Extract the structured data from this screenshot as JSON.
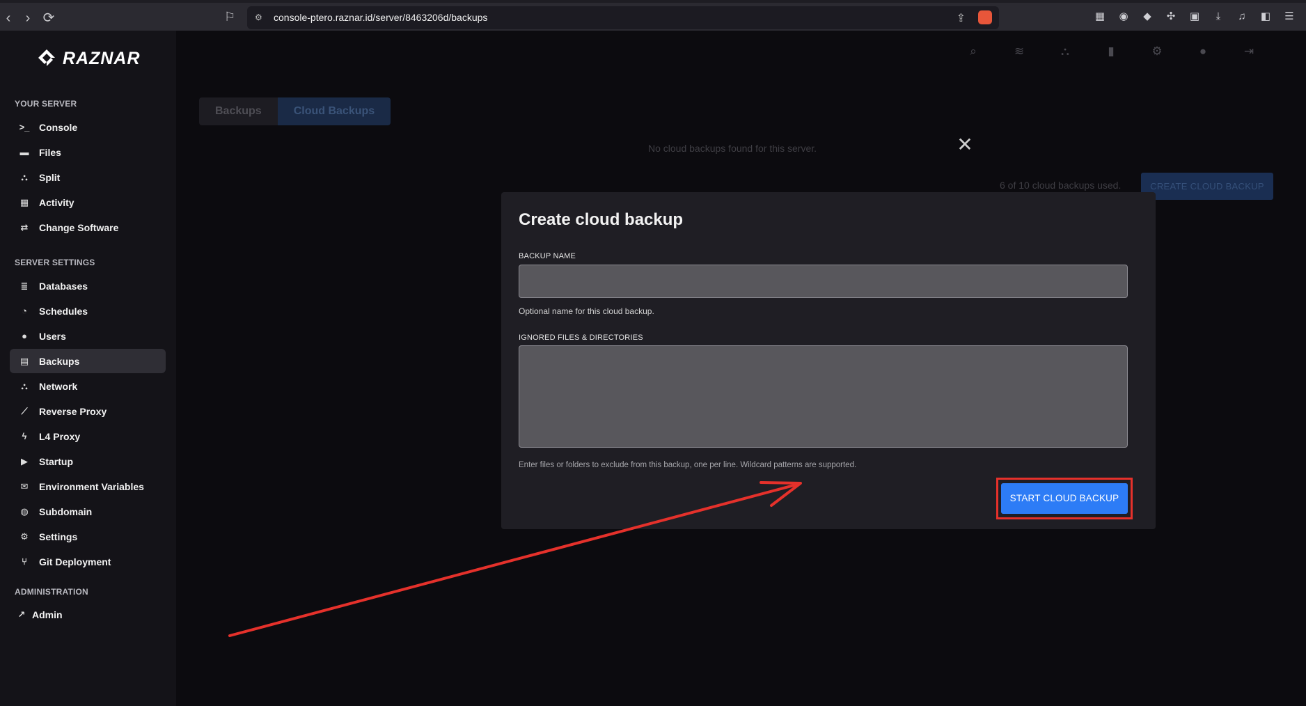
{
  "browser": {
    "url": "console-ptero.raznar.id/server/8463206d/backups"
  },
  "brand": {
    "name": "RAZNAR"
  },
  "sidebar": {
    "sections": [
      {
        "title": "YOUR SERVER",
        "items": [
          {
            "label": "Console",
            "icon": "terminal-icon"
          },
          {
            "label": "Files",
            "icon": "folder-icon"
          },
          {
            "label": "Split",
            "icon": "sitemap-icon"
          },
          {
            "label": "Activity",
            "icon": "calendar-icon"
          },
          {
            "label": "Change Software",
            "icon": "swap-icon"
          }
        ]
      },
      {
        "title": "SERVER SETTINGS",
        "items": [
          {
            "label": "Databases",
            "icon": "database-icon"
          },
          {
            "label": "Schedules",
            "icon": "clock-icon"
          },
          {
            "label": "Users",
            "icon": "user-icon"
          },
          {
            "label": "Backups",
            "icon": "archive-icon",
            "active": true
          },
          {
            "label": "Network",
            "icon": "network-icon"
          },
          {
            "label": "Reverse Proxy",
            "icon": "wrench-icon"
          },
          {
            "label": "L4 Proxy",
            "icon": "bolt-icon"
          },
          {
            "label": "Startup",
            "icon": "play-icon"
          },
          {
            "label": "Environment Variables",
            "icon": "envelope-icon"
          },
          {
            "label": "Subdomain",
            "icon": "globe-icon"
          },
          {
            "label": "Settings",
            "icon": "cogs-icon"
          },
          {
            "label": "Git Deployment",
            "icon": "git-icon"
          }
        ]
      },
      {
        "title": "ADMINISTRATION",
        "items": [
          {
            "label": "Admin",
            "icon": "external-link-icon"
          }
        ]
      }
    ]
  },
  "tabs": {
    "backups": "Backups",
    "cloud_backups": "Cloud Backups"
  },
  "main": {
    "empty_message": "No cloud backups found for this server.",
    "usage": "6 of 10 cloud backups used.",
    "create_button": "CREATE CLOUD BACKUP"
  },
  "modal": {
    "title": "Create cloud backup",
    "backup_name_label": "BACKUP NAME",
    "backup_name_value": "",
    "backup_name_help": "Optional name for this cloud backup.",
    "ignored_label": "IGNORED FILES & DIRECTORIES",
    "ignored_value": "",
    "ignored_help": "Enter files or folders to exclude from this backup, one per line. Wildcard patterns are supported.",
    "start_button": "START CLOUD BACKUP"
  },
  "colors": {
    "accent": "#2d7cf6",
    "annotation": "#e5312b"
  }
}
